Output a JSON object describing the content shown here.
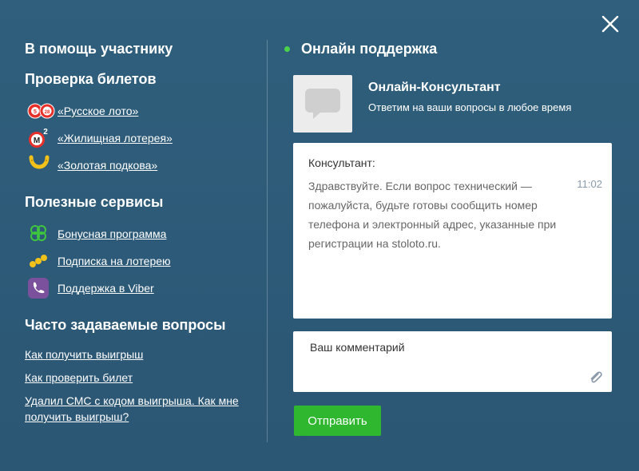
{
  "left": {
    "help_title": "В помощь участнику",
    "ticket_check_title": "Проверка билетов",
    "tickets": [
      {
        "icon": "russian-loto-icon",
        "label": "«Русское лото»"
      },
      {
        "icon": "housing-lottery-icon",
        "label": "«Жилищная лотерея»"
      },
      {
        "icon": "golden-horseshoe-icon",
        "label": "«Золотая подкова»"
      }
    ],
    "services_title": "Полезные сервисы",
    "services": [
      {
        "icon": "clover-icon",
        "label": "Бонусная программа"
      },
      {
        "icon": "subscription-icon",
        "label": "Подписка на лотерею"
      },
      {
        "icon": "viber-icon",
        "label": "Поддержка в Viber"
      }
    ],
    "faq_title": "Часто задаваемые вопросы",
    "faq": [
      "Как получить выигрыш",
      "Как проверить билет",
      "Удалил СМС с кодом выигрыша. Как мне получить выигрыш?"
    ]
  },
  "right": {
    "online_title": "Онлайн поддержка",
    "consultant_name": "Онлайн-Консультант",
    "consultant_subtitle": "Ответим на ваши вопросы в любое время",
    "chat": {
      "author": "Консультант:",
      "message": "Здравствуйте. Если вопрос технический — пожалуйста, будьте готовы сообщить номер телефона и электронный адрес, указанные при регистрации на stoloto.ru.",
      "time": "11:02"
    },
    "comment_placeholder": "Ваш комментарий",
    "send_label": "Отправить"
  },
  "colors": {
    "background": "#2e5b78",
    "online_dot": "#4bd24b",
    "send_button": "#2fb82f"
  },
  "icons": {
    "close": "close-icon",
    "attach": "paperclip-icon",
    "avatar": "chat-bubble-icon"
  }
}
